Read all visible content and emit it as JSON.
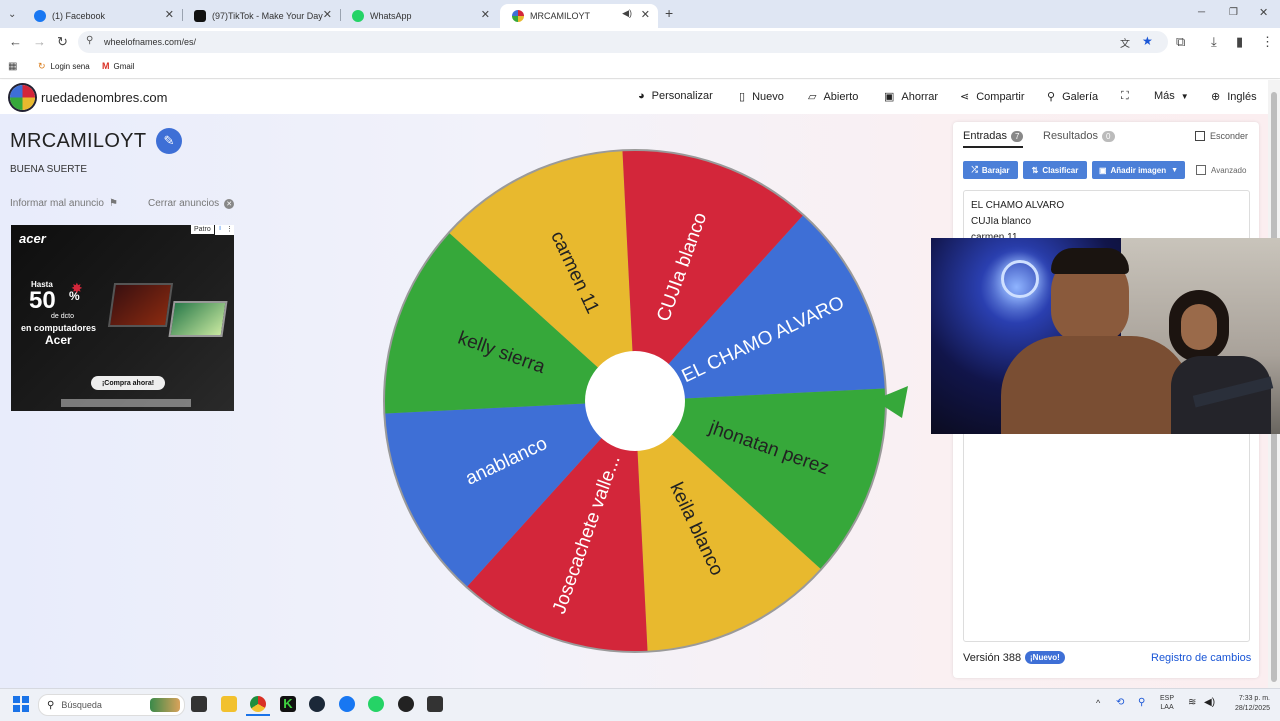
{
  "browser": {
    "tabs": [
      {
        "title": "(1) Facebook",
        "active": false
      },
      {
        "title": "(97)TikTok - Make Your Day",
        "active": false
      },
      {
        "title": "WhatsApp",
        "active": false
      },
      {
        "title": "MRCAMILOYT",
        "active": true
      }
    ],
    "url": "wheelofnames.com/es/",
    "bookmarks": [
      "Login sena",
      "Gmail"
    ]
  },
  "site": {
    "logo_text": "ruedadenombres.com",
    "nav": [
      "Personalizar",
      "Nuevo",
      "Abierto",
      "Ahorrar",
      "Compartir",
      "Galería",
      "Más",
      "Inglés"
    ]
  },
  "wheel": {
    "title": "MRCAMILOYT",
    "subtitle": "BUENA SUERTE",
    "report_ad": "Informar mal anuncio",
    "close_ads": "Cerrar anuncios",
    "segments": [
      {
        "label": "EL CHAMO ALVARO",
        "color": "#3e6fd6"
      },
      {
        "label": "jhonatan  perez",
        "color": "#36a83a"
      },
      {
        "label": "keila blanco",
        "color": "#e8b92e"
      },
      {
        "label": "Josecachete valle...",
        "color": "#d3263a"
      },
      {
        "label": "anablanco",
        "color": "#3e6fd6"
      },
      {
        "label": "kelly sierra",
        "color": "#36a83a"
      },
      {
        "label": "carmen 11",
        "color": "#e8b92e"
      },
      {
        "label": "CUJIa blanco",
        "color": "#d3263a"
      }
    ]
  },
  "ad": {
    "brand": "acer",
    "line1": "Hasta",
    "percent": "50",
    "pct_sign": "%",
    "discount": "de dcto",
    "line2": "en computadores",
    "line3": "Acer",
    "cta": "¡Compra ahora!",
    "badge": "Patro"
  },
  "panel": {
    "tab_entries": "Entradas",
    "entries_count": "7",
    "tab_results": "Resultados",
    "results_count": "0",
    "hide_label": "Esconder",
    "shuffle": "Barajar",
    "sort": "Clasificar",
    "add_image": "Añadir imagen",
    "advanced": "Avanzado",
    "entries": [
      "EL CHAMO ALVARO",
      "CUJIa blanco",
      "carmen 11"
    ],
    "version": "Versión 388",
    "new_badge": "¡Nuevo!",
    "changelog": "Registro de cambios"
  },
  "taskbar": {
    "search_placeholder": "Búsqueda",
    "lang": "ESP",
    "lang2": "LAA",
    "time": "7:33 p. m.",
    "date": "28/12/2025"
  },
  "colors": {
    "accent": "#4b7fd8",
    "red": "#d3263a",
    "blue": "#3e6fd6",
    "green": "#36a83a",
    "yellow": "#e8b92e"
  }
}
